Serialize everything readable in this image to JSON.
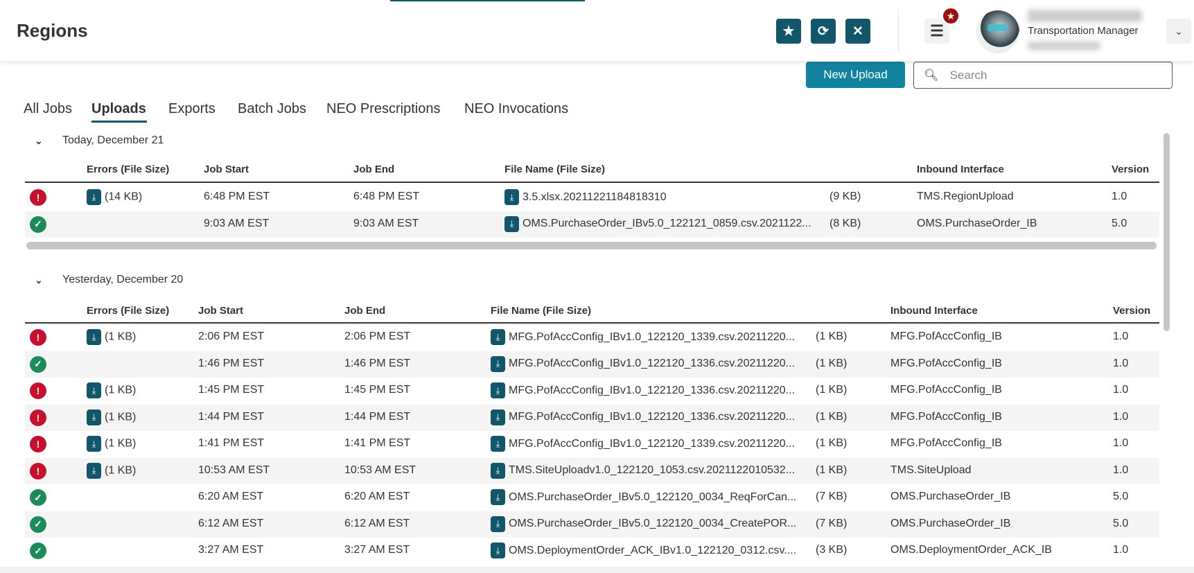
{
  "header": {
    "title": "Regions",
    "role": "Transportation Manager",
    "buttons": {
      "favorite": "★",
      "refresh": "⟳",
      "close": "✕",
      "menu": "☰",
      "badge": "★",
      "chevron": "⌄"
    }
  },
  "toolbar": {
    "new_upload": "New Upload",
    "search_placeholder": "Search"
  },
  "tabs": [
    "All Jobs",
    "Uploads",
    "Exports",
    "Batch Jobs",
    "NEO Prescriptions",
    "NEO Invocations"
  ],
  "active_tab": "Uploads",
  "columns": [
    "Errors (File Size)",
    "Job Start",
    "Job End",
    "File Name (File Size)",
    "Inbound Interface",
    "Version"
  ],
  "colors": {
    "primary": "#11566a",
    "accent": "#12839e",
    "error": "#c8102e",
    "success": "#1c8a5a"
  },
  "groups": [
    {
      "label": "Today, December 21",
      "rows": [
        {
          "status": "error",
          "errors": "(14 KB)",
          "start": "6:48 PM EST",
          "end": "6:48 PM EST",
          "file": "3.5.xlsx.20211221184818310",
          "size": "(9 KB)",
          "interface": "TMS.RegionUpload",
          "version": "1.0"
        },
        {
          "status": "success",
          "errors": "",
          "start": "9:03 AM EST",
          "end": "9:03 AM EST",
          "file": "OMS.PurchaseOrder_IBv5.0_122121_0859.csv.2021122...",
          "size": "(8 KB)",
          "interface": "OMS.PurchaseOrder_IB",
          "version": "5.0"
        }
      ]
    },
    {
      "label": "Yesterday, December 20",
      "rows": [
        {
          "status": "error",
          "errors": "(1 KB)",
          "start": "2:06 PM EST",
          "end": "2:06 PM EST",
          "file": "MFG.PofAccConfig_IBv1.0_122120_1339.csv.20211220...",
          "size": "(1 KB)",
          "interface": "MFG.PofAccConfig_IB",
          "version": "1.0"
        },
        {
          "status": "success",
          "errors": "",
          "start": "1:46 PM EST",
          "end": "1:46 PM EST",
          "file": "MFG.PofAccConfig_IBv1.0_122120_1336.csv.20211220...",
          "size": "(1 KB)",
          "interface": "MFG.PofAccConfig_IB",
          "version": "1.0"
        },
        {
          "status": "error",
          "errors": "(1 KB)",
          "start": "1:45 PM EST",
          "end": "1:45 PM EST",
          "file": "MFG.PofAccConfig_IBv1.0_122120_1336.csv.20211220...",
          "size": "(1 KB)",
          "interface": "MFG.PofAccConfig_IB",
          "version": "1.0"
        },
        {
          "status": "error",
          "errors": "(1 KB)",
          "start": "1:44 PM EST",
          "end": "1:44 PM EST",
          "file": "MFG.PofAccConfig_IBv1.0_122120_1336.csv.20211220...",
          "size": "(1 KB)",
          "interface": "MFG.PofAccConfig_IB",
          "version": "1.0"
        },
        {
          "status": "error",
          "errors": "(1 KB)",
          "start": "1:41 PM EST",
          "end": "1:41 PM EST",
          "file": "MFG.PofAccConfig_IBv1.0_122120_1339.csv.20211220...",
          "size": "(1 KB)",
          "interface": "MFG.PofAccConfig_IB",
          "version": "1.0"
        },
        {
          "status": "error",
          "errors": "(1 KB)",
          "start": "10:53 AM EST",
          "end": "10:53 AM EST",
          "file": "TMS.SiteUploadv1.0_122120_1053.csv.2021122010532...",
          "size": "(1 KB)",
          "interface": "TMS.SiteUpload",
          "version": "1.0"
        },
        {
          "status": "success",
          "errors": "",
          "start": "6:20 AM EST",
          "end": "6:20 AM EST",
          "file": "OMS.PurchaseOrder_IBv5.0_122120_0034_ReqForCan...",
          "size": "(7 KB)",
          "interface": "OMS.PurchaseOrder_IB",
          "version": "5.0"
        },
        {
          "status": "success",
          "errors": "",
          "start": "6:12 AM EST",
          "end": "6:12 AM EST",
          "file": "OMS.PurchaseOrder_IBv5.0_122120_0034_CreatePOR...",
          "size": "(7 KB)",
          "interface": "OMS.PurchaseOrder_IB",
          "version": "5.0"
        },
        {
          "status": "success",
          "errors": "",
          "start": "3:27 AM EST",
          "end": "3:27 AM EST",
          "file": "OMS.DeploymentOrder_ACK_IBv1.0_122120_0312.csv....",
          "size": "(3 KB)",
          "interface": "OMS.DeploymentOrder_ACK_IB",
          "version": "1.0"
        }
      ]
    }
  ]
}
